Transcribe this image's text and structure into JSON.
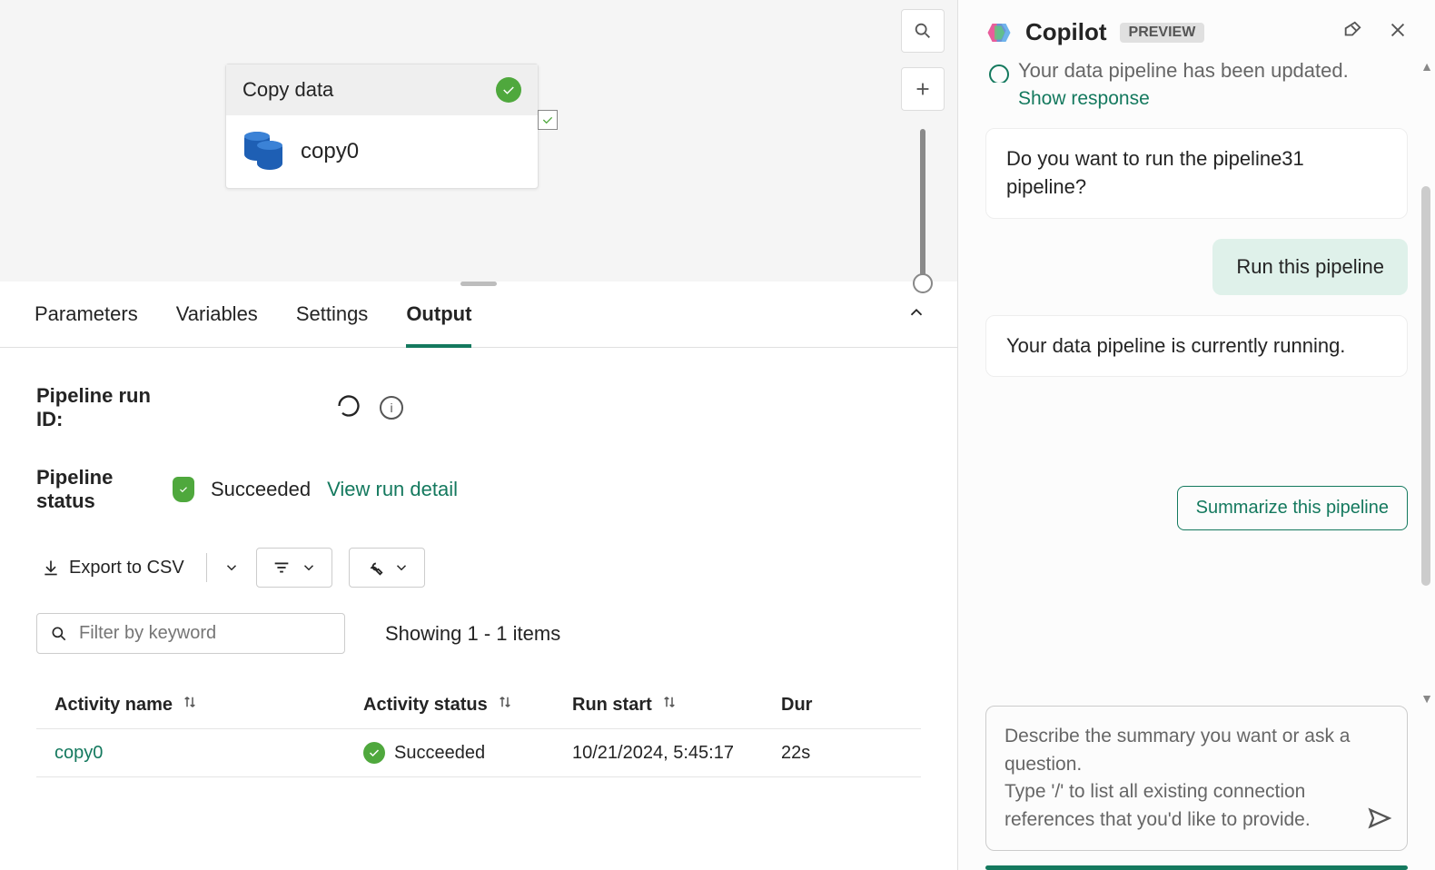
{
  "canvas": {
    "node": {
      "title": "Copy data",
      "name": "copy0"
    }
  },
  "tabs": [
    "Parameters",
    "Variables",
    "Settings",
    "Output"
  ],
  "active_tab": "Output",
  "output": {
    "run_id_label": "Pipeline run ID:",
    "status_label": "Pipeline status",
    "status_value": "Succeeded",
    "view_detail": "View run detail",
    "export": "Export to CSV",
    "filter_placeholder": "Filter by keyword",
    "showing": "Showing 1 - 1 items",
    "columns": [
      "Activity name",
      "Activity status",
      "Run start",
      "Dur"
    ],
    "rows": [
      {
        "name": "copy0",
        "status": "Succeeded",
        "start": "10/21/2024, 5:45:17",
        "duration": "22s"
      }
    ]
  },
  "copilot": {
    "title": "Copilot",
    "badge": "PREVIEW",
    "truncated_msg": "Your data pipeline has been updated.",
    "show_response": "Show response",
    "msg_question": "Do you want to run the pipeline31 pipeline?",
    "chip_run": "Run this pipeline",
    "msg_running": "Your data pipeline is currently running.",
    "suggestion": "Summarize this pipeline",
    "input_placeholder": "Describe the summary you want or ask a question.\nType '/' to list all existing connection references that you'd like to provide."
  }
}
